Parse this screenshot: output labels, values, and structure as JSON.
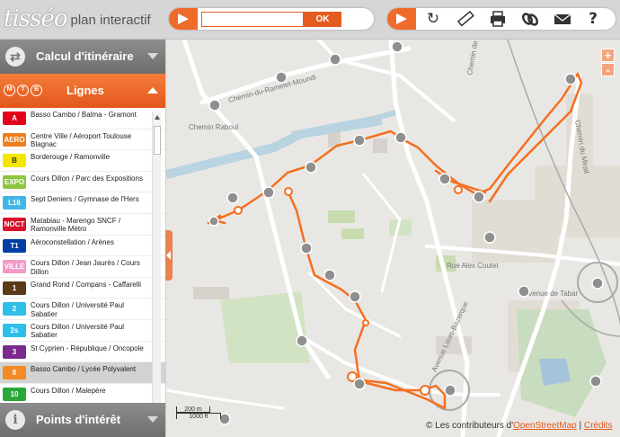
{
  "header": {
    "logo_script": "tisséo",
    "logo_sub": "plan interactif",
    "search": {
      "value": "",
      "placeholder": "",
      "ok_label": "OK"
    },
    "tools": [
      {
        "icon": "refresh-icon",
        "glyph": "↻"
      },
      {
        "icon": "ruler-icon",
        "glyph": "📏"
      },
      {
        "icon": "printer-icon",
        "glyph": "🖶"
      },
      {
        "icon": "link-icon",
        "glyph": "∞"
      },
      {
        "icon": "mail-icon",
        "glyph": "✉"
      },
      {
        "icon": "help-icon",
        "glyph": "?"
      }
    ]
  },
  "sidebar": {
    "itinerary": {
      "label": "Calcul d'itinéraire",
      "icon": "route-icon"
    },
    "lines": {
      "label": "Lignes",
      "modes": [
        "M",
        "T",
        "B"
      ]
    },
    "poi": {
      "label": "Points d'intérêt",
      "icon": "info-icon"
    },
    "items": [
      {
        "code": "A",
        "color": "#e2001a",
        "name": "Basso Cambo / Balma - Gramont"
      },
      {
        "code": "AERO",
        "color": "#f07d1f",
        "name": "Centre Ville / Aéroport Toulouse Blagnac"
      },
      {
        "code": "B",
        "color": "#f5e600",
        "text_color": "#333333",
        "name": "Borderouge / Ramonville"
      },
      {
        "code": "EXPO",
        "color": "#8ec63f",
        "name": "Cours Dillon / Parc des Expositions"
      },
      {
        "code": "L16",
        "color": "#41b6e6",
        "name": "Sept Deniers / Gymnase de l'Hers"
      },
      {
        "code": "NOCT",
        "color": "#d7132b",
        "name": "Matabiau - Marengo SNCF / Ramonville Métro"
      },
      {
        "code": "T1",
        "color": "#003da5",
        "name": "Aéroconstellation / Arènes"
      },
      {
        "code": "VILLE",
        "color": "#f49ac8",
        "name": "Cours Dillon / Jean Jaurès / Cours Dillon"
      },
      {
        "code": "1",
        "color": "#5b3a17",
        "name": "Grand Rond / Compans - Caffarelli"
      },
      {
        "code": "2",
        "color": "#2ebee8",
        "name": "Cours Dillon / Université Paul Sabatier"
      },
      {
        "code": "2s",
        "color": "#2ebee8",
        "name": "Cours Dillon / Université Paul Sabatier"
      },
      {
        "code": "3",
        "color": "#7a2a8c",
        "name": "St Cyprien - République / Oncopole"
      },
      {
        "code": "8",
        "color": "#f28a25",
        "name": "Basso Cambo / Lycée Polyvalent",
        "selected": true
      },
      {
        "code": "10",
        "color": "#2aa839",
        "name": "Cours Dillon / Malepère"
      }
    ]
  },
  "map": {
    "streets": [
      "Chemin-du-Ramelet-Moundi",
      "Chemin Raboul",
      "Chemin du Mirail",
      "Rue Alex Coutet",
      "Avenue de Tabar",
      "Avenue Louis-Bazerque",
      "Chemin de la Fourche"
    ],
    "route_color": "#f37021",
    "scale": {
      "metric": "200 m",
      "imperial": "1000 ft"
    },
    "zoom_in": "+",
    "zoom_out": "-",
    "credits": {
      "prefix": "© Les contributeurs d'",
      "osm": "OpenStreetMap",
      "sep": " | ",
      "credits": "Crédits"
    }
  }
}
